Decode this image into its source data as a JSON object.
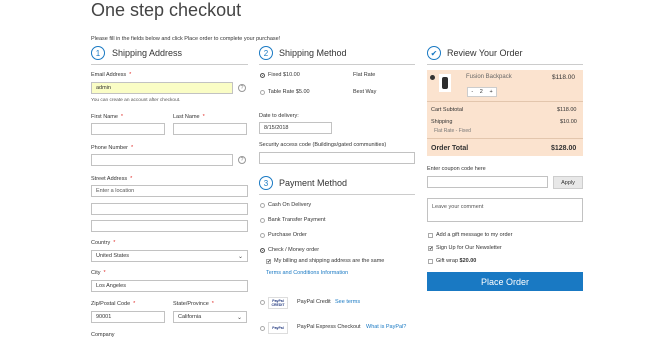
{
  "page": {
    "title": "One step checkout",
    "intro": "Please fill in the fields below and click Place order to complete your purchase!"
  },
  "shipping_address": {
    "step": "1",
    "title": "Shipping Address",
    "email_label": "Email Address",
    "email_value": "admin",
    "email_note": "You can create an account after checkout.",
    "first_name_label": "First Name",
    "last_name_label": "Last Name",
    "phone_label": "Phone Number",
    "street_label": "Street Address",
    "street_placeholder": "Enter a location",
    "country_label": "Country",
    "country_value": "United States",
    "city_label": "City",
    "city_value": "Los Angeles",
    "zip_label": "Zip/Postal Code",
    "zip_value": "90001",
    "state_label": "State/Province",
    "state_value": "California",
    "company_label": "Company",
    "required_mark": "*",
    "help_mark": "?"
  },
  "shipping_method": {
    "step": "2",
    "title": "Shipping Method",
    "options": [
      {
        "price": "Fixed $10.00",
        "name": "Flat Rate",
        "selected": true
      },
      {
        "price": "Table Rate $5.00",
        "name": "Best Way",
        "selected": false
      }
    ],
    "date_label": "Date to delivery:",
    "date_value": "8/15/2018",
    "security_label": "Security access code (Buildings/gated communities)"
  },
  "payment_method": {
    "step": "3",
    "title": "Payment Method",
    "options": [
      {
        "label": "Cash On Delivery",
        "selected": false
      },
      {
        "label": "Bank Transfer Payment",
        "selected": false
      },
      {
        "label": "Purchase Order",
        "selected": false
      },
      {
        "label": "Check / Money order",
        "selected": true
      }
    ],
    "billing_same": "My billing and shipping address are the same",
    "terms_link": "Terms and Conditions Information",
    "paypal_credit": "PayPal Credit",
    "see_terms": "See terms",
    "paypal_express": "PayPal Express Checkout",
    "what_is_paypal": "What is PayPal?",
    "paypal_logo_text": "PayPal",
    "paypal_credit_logo_text": "CREDIT"
  },
  "review": {
    "title": "Review Your Order",
    "item_name": "Fusion Backpack",
    "item_price": "$118.00",
    "qty": "2",
    "qty_minus": "-",
    "qty_plus": "+",
    "subtotal_label": "Cart Subtotal",
    "subtotal_value": "$118.00",
    "shipping_label": "Shipping",
    "shipping_value": "$10.00",
    "shipping_note": "Flat Rate - Fixed",
    "total_label": "Order Total",
    "total_value": "$128.00",
    "coupon_label": "Enter coupon code here",
    "apply_label": "Apply",
    "comment_placeholder": "Leave your comment",
    "gift_message": "Add a gift message to my order",
    "newsletter": "Sign Up for Our Newsletter",
    "gift_wrap": "Gift wrap",
    "gift_wrap_price": "$20.00",
    "place_order": "Place Order",
    "check_mark": "✔"
  },
  "colors": {
    "accent": "#1979c3",
    "review_bg": "#fbe3cf",
    "email_bg": "#fafdc5",
    "required": "#e02b27"
  }
}
